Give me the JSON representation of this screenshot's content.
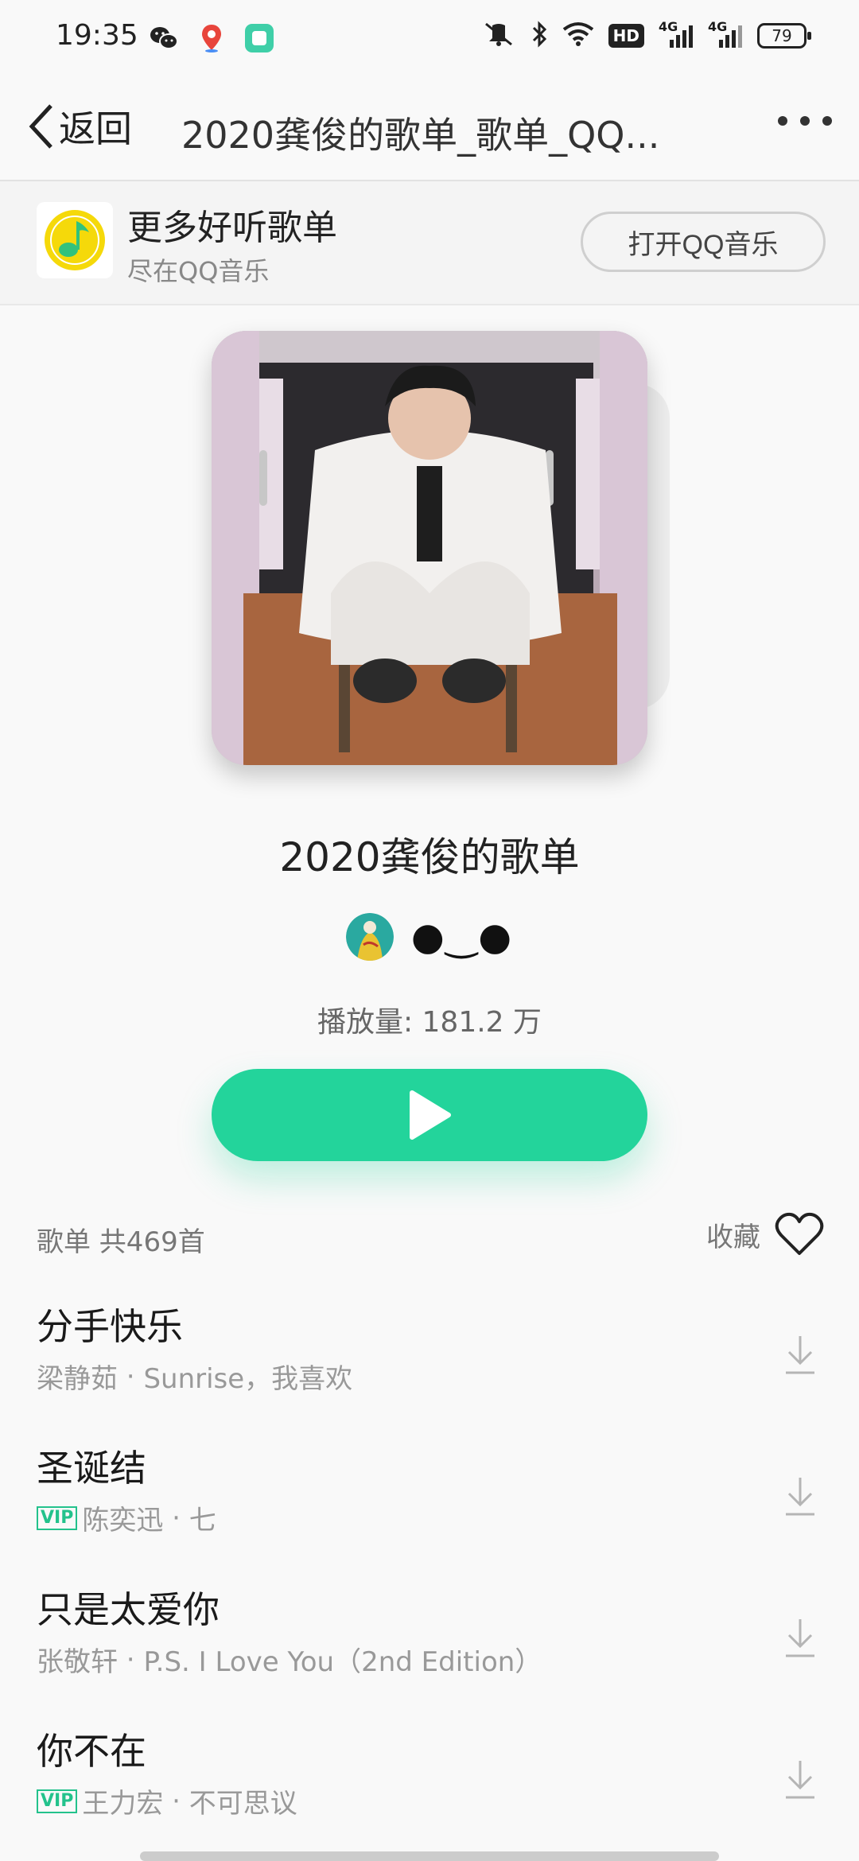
{
  "status_bar": {
    "time": "19:35",
    "battery": "79",
    "hd_badge": "HD",
    "network_1": "4G",
    "network_2": "4G",
    "app_icons": [
      "wechat-icon",
      "baidu-map-icon",
      "app-icon"
    ],
    "system_icons": [
      "mute-icon",
      "bluetooth-icon",
      "wifi-icon"
    ]
  },
  "nav": {
    "back_label": "返回",
    "title": "2020龚俊的歌单_歌单_QQ..."
  },
  "promo": {
    "title": "更多好听歌单",
    "subtitle": "尽在QQ音乐",
    "open_button": "打开QQ音乐"
  },
  "playlist": {
    "title": "2020龚俊的歌单",
    "creator_name": "●‿●",
    "play_count": "播放量: 181.2 万"
  },
  "list_header": {
    "count_label": "歌单  共469首",
    "favorite_label": "收藏"
  },
  "songs": [
    {
      "title": "分手快乐",
      "vip": false,
      "artist": "梁静茹",
      "album": "Sunrise，我喜欢"
    },
    {
      "title": "圣诞结",
      "vip": true,
      "artist": "陈奕迅",
      "album": "七"
    },
    {
      "title": "只是太爱你",
      "vip": false,
      "artist": "张敬轩",
      "album": "P.S. I Love You（2nd Edition）"
    },
    {
      "title": "你不在",
      "vip": true,
      "artist": "王力宏",
      "album": "不可思议"
    }
  ],
  "vip_label": "VIP",
  "meta_separator": " · ",
  "colors": {
    "accent_green": "#23d49b",
    "vip_green": "#23c28c",
    "qq_music_yellow": "#f5d90a"
  }
}
